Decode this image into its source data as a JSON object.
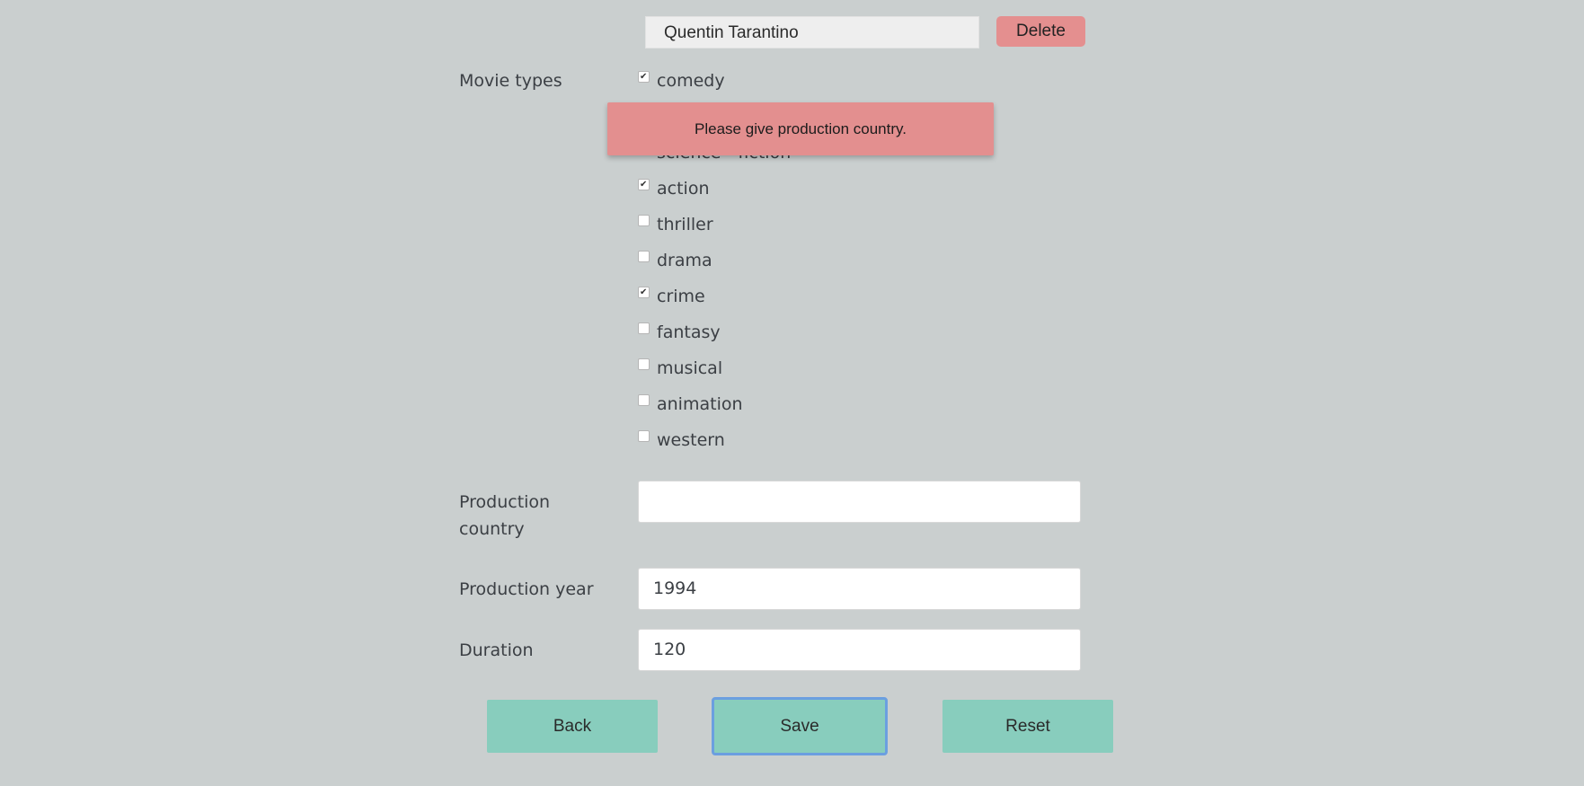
{
  "director": {
    "value": "Quentin Tarantino",
    "delete_label": "Delete"
  },
  "movie_types": {
    "label": "Movie types",
    "items": [
      {
        "label": "comedy",
        "checked": true
      },
      {
        "label": "science - fiction",
        "checked": false
      },
      {
        "label": "action",
        "checked": true
      },
      {
        "label": "thriller",
        "checked": false
      },
      {
        "label": "drama",
        "checked": false
      },
      {
        "label": "crime",
        "checked": true
      },
      {
        "label": "fantasy",
        "checked": false
      },
      {
        "label": "musical",
        "checked": false
      },
      {
        "label": "animation",
        "checked": false
      },
      {
        "label": "western",
        "checked": false
      }
    ]
  },
  "toast": {
    "message": "Please give production country."
  },
  "fields": {
    "production_country": {
      "label_line1": "Production",
      "label_line2": "country",
      "value": ""
    },
    "production_year": {
      "label": "Production year",
      "value": "1994"
    },
    "duration": {
      "label": "Duration",
      "value": "120"
    }
  },
  "buttons": {
    "back": "Back",
    "save": "Save",
    "reset": "Reset"
  }
}
